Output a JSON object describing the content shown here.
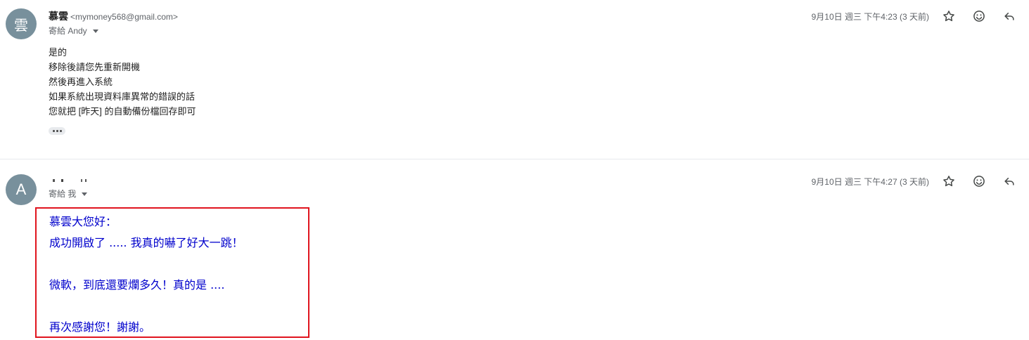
{
  "messages": [
    {
      "avatar_letter": "雲",
      "sender_name": "慕雲",
      "sender_email": "<mymoney568@gmail.com>",
      "recipient_label": "寄給 Andy",
      "date": "9月10日 週三 下午4:23 (3 天前)",
      "body_lines": [
        "是的",
        "移除後請您先重新開機",
        "然後再進入系統",
        "如果系統出現資料庫異常的錯誤的話",
        "您就把 [昨天] 的自動備份檔回存即可"
      ],
      "show_trimmed_content_icon": "ellipsis-icon"
    },
    {
      "avatar_letter": "A",
      "sender_name": "",
      "recipient_label": "寄給 我",
      "date": "9月10日 週三 下午4:27 (3 天前)",
      "body_lines": [
        "慕雲大您好：",
        "成功開啟了 .....  我真的嚇了好大一跳！",
        "",
        "微軟，到底還要爛多久！真的是 ....",
        "",
        "再次感謝您！謝謝。"
      ]
    }
  ],
  "icons": {
    "star": "star-icon",
    "emoji": "smiley-icon",
    "reply": "reply-icon",
    "recipients_dropdown": "chevron-down-icon"
  },
  "colors": {
    "avatar_bg": "#78909c",
    "highlight_border": "#e0141e",
    "reply_text": "#0000cc"
  }
}
